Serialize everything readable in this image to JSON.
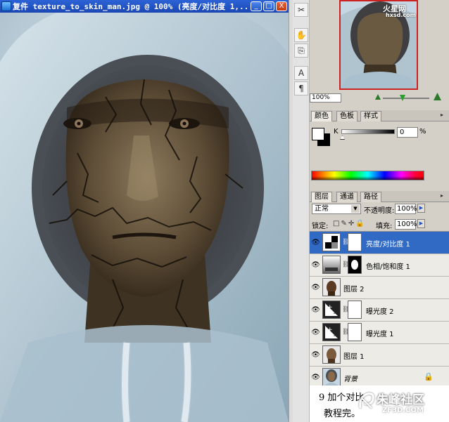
{
  "window": {
    "title": "复件 texture_to_skin_man.jpg @ 100% (亮度/对比度 1,...",
    "minimize": "_",
    "maximize": "□",
    "close": "X"
  },
  "toolbar": {
    "tools": [
      "✂",
      "✋",
      "⎘",
      "A",
      "¶"
    ]
  },
  "navigator": {
    "zoom": "100%",
    "watermark_logo": "火星网",
    "watermark_url": "hxsd.com"
  },
  "color_panel": {
    "tabs": [
      "颜色",
      "色板",
      "样式"
    ],
    "channel_label": "K",
    "channel_value": "0",
    "unit": "%"
  },
  "layers_panel": {
    "tabs": [
      "图层",
      "通道",
      "路径"
    ],
    "blend_mode": "正常",
    "opacity_label": "不透明度:",
    "opacity": "100%",
    "lock_label": "锁定:",
    "lock_icons": "□✎✛🔒",
    "fill_label": "填充:",
    "fill": "100%",
    "layers": [
      {
        "name": "亮度/对比度 1",
        "type": "adjust-brightness",
        "selected": true
      },
      {
        "name": "色相/饱和度 1",
        "type": "adjust-huesat",
        "selected": false
      },
      {
        "name": "图层 2",
        "type": "pixel",
        "selected": false
      },
      {
        "name": "曝光度 2",
        "type": "adjust-exposure",
        "selected": false
      },
      {
        "name": "曝光度 1",
        "type": "adjust-exposure",
        "selected": false
      },
      {
        "name": "图层 1",
        "type": "pixel",
        "selected": false
      },
      {
        "name": "背景",
        "type": "background",
        "selected": false
      }
    ]
  },
  "caption": {
    "line1": "9 加个对比",
    "line2": "教程完。",
    "watermark_brand": "朱峰社区",
    "watermark_url": "ZF3D.COM"
  },
  "colors": {
    "title_bar": "#1b47b3",
    "selection": "#316ac5",
    "panel_bg": "#d4d0c8",
    "hoodie": "#bcd0dc",
    "skin": "#6b5a42"
  }
}
